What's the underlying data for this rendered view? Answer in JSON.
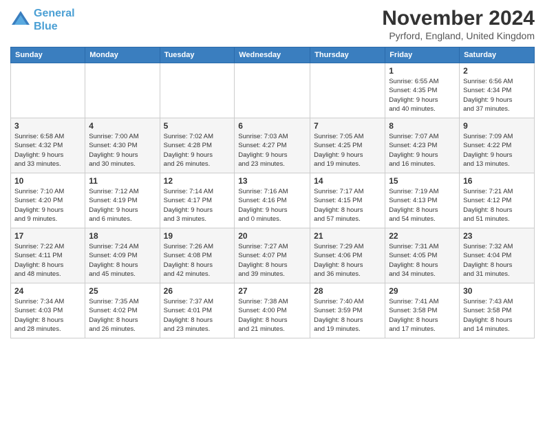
{
  "header": {
    "logo_line1": "General",
    "logo_line2": "Blue",
    "month_title": "November 2024",
    "location": "Pyrford, England, United Kingdom"
  },
  "weekdays": [
    "Sunday",
    "Monday",
    "Tuesday",
    "Wednesday",
    "Thursday",
    "Friday",
    "Saturday"
  ],
  "weeks": [
    [
      {
        "day": "",
        "info": ""
      },
      {
        "day": "",
        "info": ""
      },
      {
        "day": "",
        "info": ""
      },
      {
        "day": "",
        "info": ""
      },
      {
        "day": "",
        "info": ""
      },
      {
        "day": "1",
        "info": "Sunrise: 6:55 AM\nSunset: 4:35 PM\nDaylight: 9 hours\nand 40 minutes."
      },
      {
        "day": "2",
        "info": "Sunrise: 6:56 AM\nSunset: 4:34 PM\nDaylight: 9 hours\nand 37 minutes."
      }
    ],
    [
      {
        "day": "3",
        "info": "Sunrise: 6:58 AM\nSunset: 4:32 PM\nDaylight: 9 hours\nand 33 minutes."
      },
      {
        "day": "4",
        "info": "Sunrise: 7:00 AM\nSunset: 4:30 PM\nDaylight: 9 hours\nand 30 minutes."
      },
      {
        "day": "5",
        "info": "Sunrise: 7:02 AM\nSunset: 4:28 PM\nDaylight: 9 hours\nand 26 minutes."
      },
      {
        "day": "6",
        "info": "Sunrise: 7:03 AM\nSunset: 4:27 PM\nDaylight: 9 hours\nand 23 minutes."
      },
      {
        "day": "7",
        "info": "Sunrise: 7:05 AM\nSunset: 4:25 PM\nDaylight: 9 hours\nand 19 minutes."
      },
      {
        "day": "8",
        "info": "Sunrise: 7:07 AM\nSunset: 4:23 PM\nDaylight: 9 hours\nand 16 minutes."
      },
      {
        "day": "9",
        "info": "Sunrise: 7:09 AM\nSunset: 4:22 PM\nDaylight: 9 hours\nand 13 minutes."
      }
    ],
    [
      {
        "day": "10",
        "info": "Sunrise: 7:10 AM\nSunset: 4:20 PM\nDaylight: 9 hours\nand 9 minutes."
      },
      {
        "day": "11",
        "info": "Sunrise: 7:12 AM\nSunset: 4:19 PM\nDaylight: 9 hours\nand 6 minutes."
      },
      {
        "day": "12",
        "info": "Sunrise: 7:14 AM\nSunset: 4:17 PM\nDaylight: 9 hours\nand 3 minutes."
      },
      {
        "day": "13",
        "info": "Sunrise: 7:16 AM\nSunset: 4:16 PM\nDaylight: 9 hours\nand 0 minutes."
      },
      {
        "day": "14",
        "info": "Sunrise: 7:17 AM\nSunset: 4:15 PM\nDaylight: 8 hours\nand 57 minutes."
      },
      {
        "day": "15",
        "info": "Sunrise: 7:19 AM\nSunset: 4:13 PM\nDaylight: 8 hours\nand 54 minutes."
      },
      {
        "day": "16",
        "info": "Sunrise: 7:21 AM\nSunset: 4:12 PM\nDaylight: 8 hours\nand 51 minutes."
      }
    ],
    [
      {
        "day": "17",
        "info": "Sunrise: 7:22 AM\nSunset: 4:11 PM\nDaylight: 8 hours\nand 48 minutes."
      },
      {
        "day": "18",
        "info": "Sunrise: 7:24 AM\nSunset: 4:09 PM\nDaylight: 8 hours\nand 45 minutes."
      },
      {
        "day": "19",
        "info": "Sunrise: 7:26 AM\nSunset: 4:08 PM\nDaylight: 8 hours\nand 42 minutes."
      },
      {
        "day": "20",
        "info": "Sunrise: 7:27 AM\nSunset: 4:07 PM\nDaylight: 8 hours\nand 39 minutes."
      },
      {
        "day": "21",
        "info": "Sunrise: 7:29 AM\nSunset: 4:06 PM\nDaylight: 8 hours\nand 36 minutes."
      },
      {
        "day": "22",
        "info": "Sunrise: 7:31 AM\nSunset: 4:05 PM\nDaylight: 8 hours\nand 34 minutes."
      },
      {
        "day": "23",
        "info": "Sunrise: 7:32 AM\nSunset: 4:04 PM\nDaylight: 8 hours\nand 31 minutes."
      }
    ],
    [
      {
        "day": "24",
        "info": "Sunrise: 7:34 AM\nSunset: 4:03 PM\nDaylight: 8 hours\nand 28 minutes."
      },
      {
        "day": "25",
        "info": "Sunrise: 7:35 AM\nSunset: 4:02 PM\nDaylight: 8 hours\nand 26 minutes."
      },
      {
        "day": "26",
        "info": "Sunrise: 7:37 AM\nSunset: 4:01 PM\nDaylight: 8 hours\nand 23 minutes."
      },
      {
        "day": "27",
        "info": "Sunrise: 7:38 AM\nSunset: 4:00 PM\nDaylight: 8 hours\nand 21 minutes."
      },
      {
        "day": "28",
        "info": "Sunrise: 7:40 AM\nSunset: 3:59 PM\nDaylight: 8 hours\nand 19 minutes."
      },
      {
        "day": "29",
        "info": "Sunrise: 7:41 AM\nSunset: 3:58 PM\nDaylight: 8 hours\nand 17 minutes."
      },
      {
        "day": "30",
        "info": "Sunrise: 7:43 AM\nSunset: 3:58 PM\nDaylight: 8 hours\nand 14 minutes."
      }
    ]
  ]
}
